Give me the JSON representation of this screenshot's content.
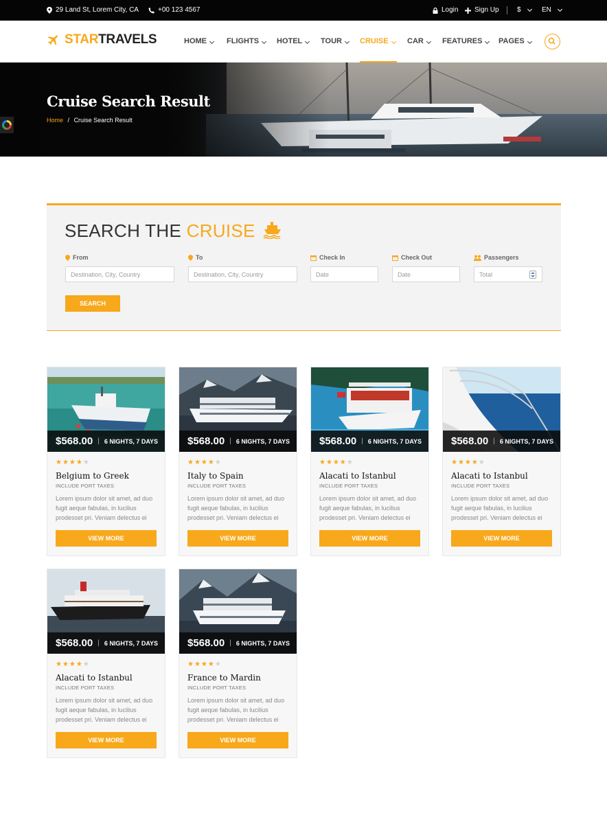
{
  "topbar": {
    "address": "29 Land St, Lorem City, CA",
    "phone": "+00 123 4567",
    "login": "Login",
    "signup": "Sign Up",
    "currency": "$",
    "language": "EN"
  },
  "brand": {
    "part1": "STAR",
    "part2": "TRAVELS"
  },
  "nav": [
    "HOME",
    "FLIGHTS",
    "HOTEL",
    "TOUR",
    "CRUISE",
    "CAR",
    "FEATURES",
    "PAGES"
  ],
  "nav_active": "CRUISE",
  "hero": {
    "title": "Cruise Search Result",
    "breadcrumb_home": "Home",
    "breadcrumb_sep": "/",
    "breadcrumb_current": "Cruise Search Result"
  },
  "search": {
    "title_part1": "SEARCH THE",
    "title_part2": "CRUISE",
    "fields": {
      "from": {
        "label": "From",
        "placeholder": "Destination, City, Country"
      },
      "to": {
        "label": "To",
        "placeholder": "Destination, City, Country"
      },
      "checkin": {
        "label": "Check In",
        "placeholder": "Date"
      },
      "checkout": {
        "label": "Check Out",
        "placeholder": "Date"
      },
      "passengers": {
        "label": "Passengers",
        "placeholder": "Total"
      }
    },
    "button": "SEARCH"
  },
  "cards": [
    {
      "price": "$568.00",
      "nights": "6 NIGHTS, 7 DAYS",
      "rating": 4,
      "title": "Belgium to Greek",
      "sub": "INCLUDE PORT TAXES",
      "desc": "Lorem ipsum dolor sit amet, ad duo fugit aeque fabulas, in lucilius prodesset pri. Veniam delectus ei",
      "button": "VIEW MORE",
      "image": "fishing-boat"
    },
    {
      "price": "$568.00",
      "nights": "6 NIGHTS, 7 DAYS",
      "rating": 4,
      "title": "Italy to Spain",
      "sub": "INCLUDE PORT TAXES",
      "desc": "Lorem ipsum dolor sit amet, ad duo fugit aeque fabulas, in lucilius prodesset pri. Veniam delectus ei",
      "button": "VIEW MORE",
      "image": "cruise-ship-fjord"
    },
    {
      "price": "$568.00",
      "nights": "6 NIGHTS, 7 DAYS",
      "rating": 4,
      "title": "Alacati to Istanbul",
      "sub": "INCLUDE PORT TAXES",
      "desc": "Lorem ipsum dolor sit amet, ad duo fugit aeque fabulas, in lucilius prodesset pri. Veniam delectus ei",
      "button": "VIEW MORE",
      "image": "tour-boat"
    },
    {
      "price": "$568.00",
      "nights": "6 NIGHTS, 7 DAYS",
      "rating": 4,
      "title": "Alacati to Istanbul",
      "sub": "INCLUDE PORT TAXES",
      "desc": "Lorem ipsum dolor sit amet, ad duo fugit aeque fabulas, in lucilius prodesset pri. Veniam delectus ei",
      "button": "VIEW MORE",
      "image": "yacht-bow"
    },
    {
      "price": "$568.00",
      "nights": "6 NIGHTS, 7 DAYS",
      "rating": 4,
      "title": "Alacati to Istanbul",
      "sub": "INCLUDE PORT TAXES",
      "desc": "Lorem ipsum dolor sit amet, ad duo fugit aeque fabulas, in lucilius prodesset pri. Veniam delectus ei",
      "button": "VIEW MORE",
      "image": "ocean-liner"
    },
    {
      "price": "$568.00",
      "nights": "6 NIGHTS, 7 DAYS",
      "rating": 4,
      "title": "France to Mardin",
      "sub": "INCLUDE PORT TAXES",
      "desc": "Lorem ipsum dolor sit amet, ad duo fugit aeque fabulas, in lucilius prodesset pri. Veniam delectus ei",
      "button": "VIEW MORE",
      "image": "cruise-ship-mountains"
    }
  ],
  "colors": {
    "accent": "#f7a81b",
    "topbar": "#050505",
    "panel": "#f3f3f3"
  }
}
